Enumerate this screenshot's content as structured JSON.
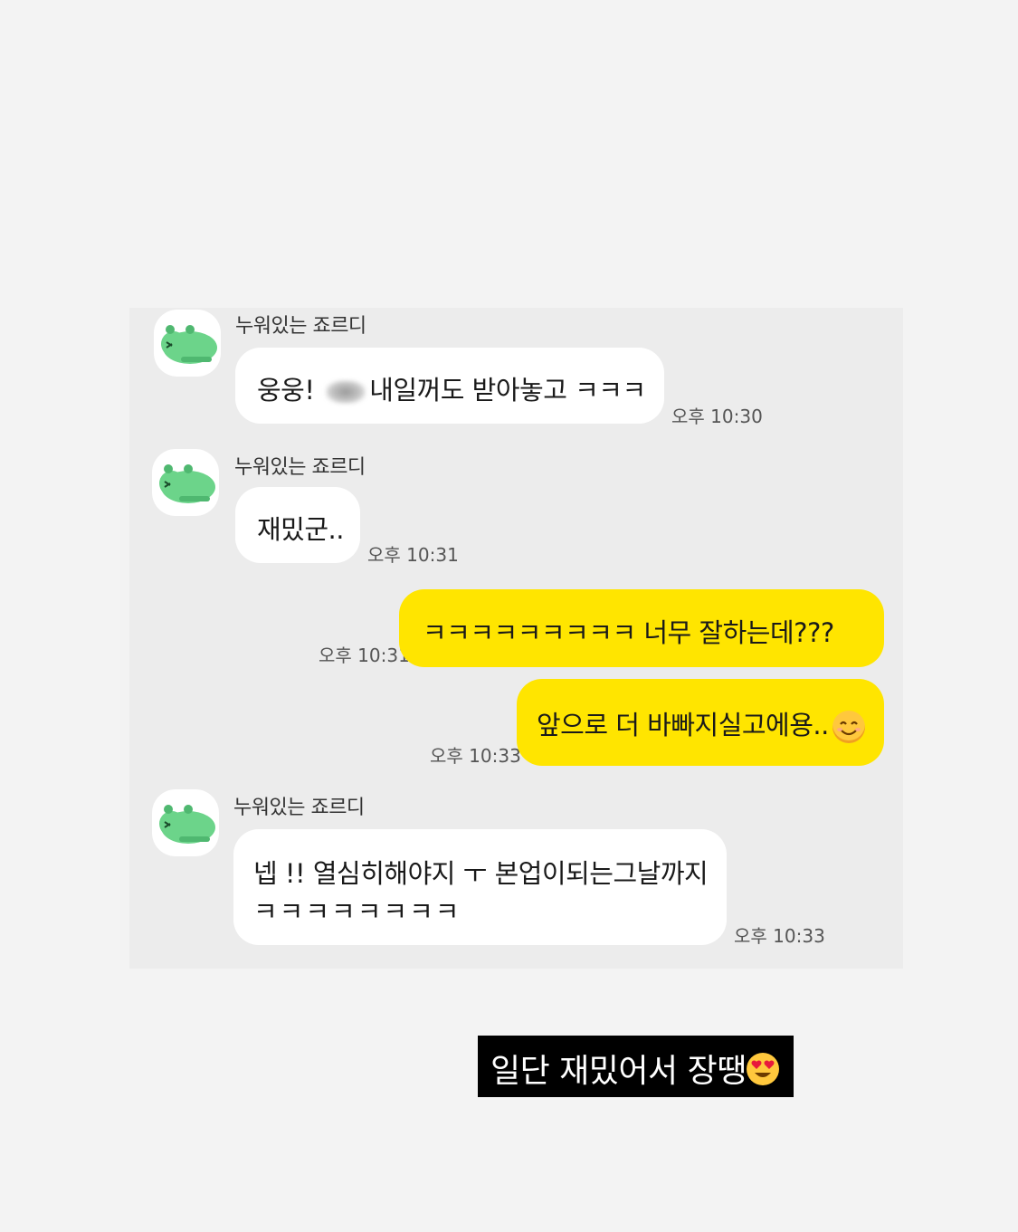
{
  "messages": [
    {
      "sender": "누워있는 죠르디",
      "before_blur": "웅웅! ",
      "text": "내일꺼도 받아놓고 ㅋㅋㅋ",
      "time": "오후 10:30"
    },
    {
      "sender": "누워있는 죠르디",
      "text": "재밌군..",
      "time": "오후 10:31"
    },
    {
      "text": "ㅋㅋㅋㅋㅋㅋㅋㅋㅋ 너무 잘하는데???",
      "time": "오후 10:31"
    },
    {
      "text": "앞으로 더 바빠지실고에용..",
      "time": "오후 10:33",
      "emoji": "smiling-face-icon"
    },
    {
      "sender": "누워있는 죠르디",
      "line1": "넵 !! 열심히해야지 ㅜ 본업이되는그날까지",
      "line2": "ㅋㅋㅋㅋㅋㅋㅋㅋ",
      "time": "오후 10:33"
    }
  ],
  "caption": {
    "text": "일단 재밌어서 장땡",
    "emoji": "heart-eyes-icon"
  },
  "colors": {
    "incoming": "#ffffff",
    "outgoing": "#ffe500",
    "caption_bg": "#000000",
    "avatar_green": "#6cd48a"
  }
}
